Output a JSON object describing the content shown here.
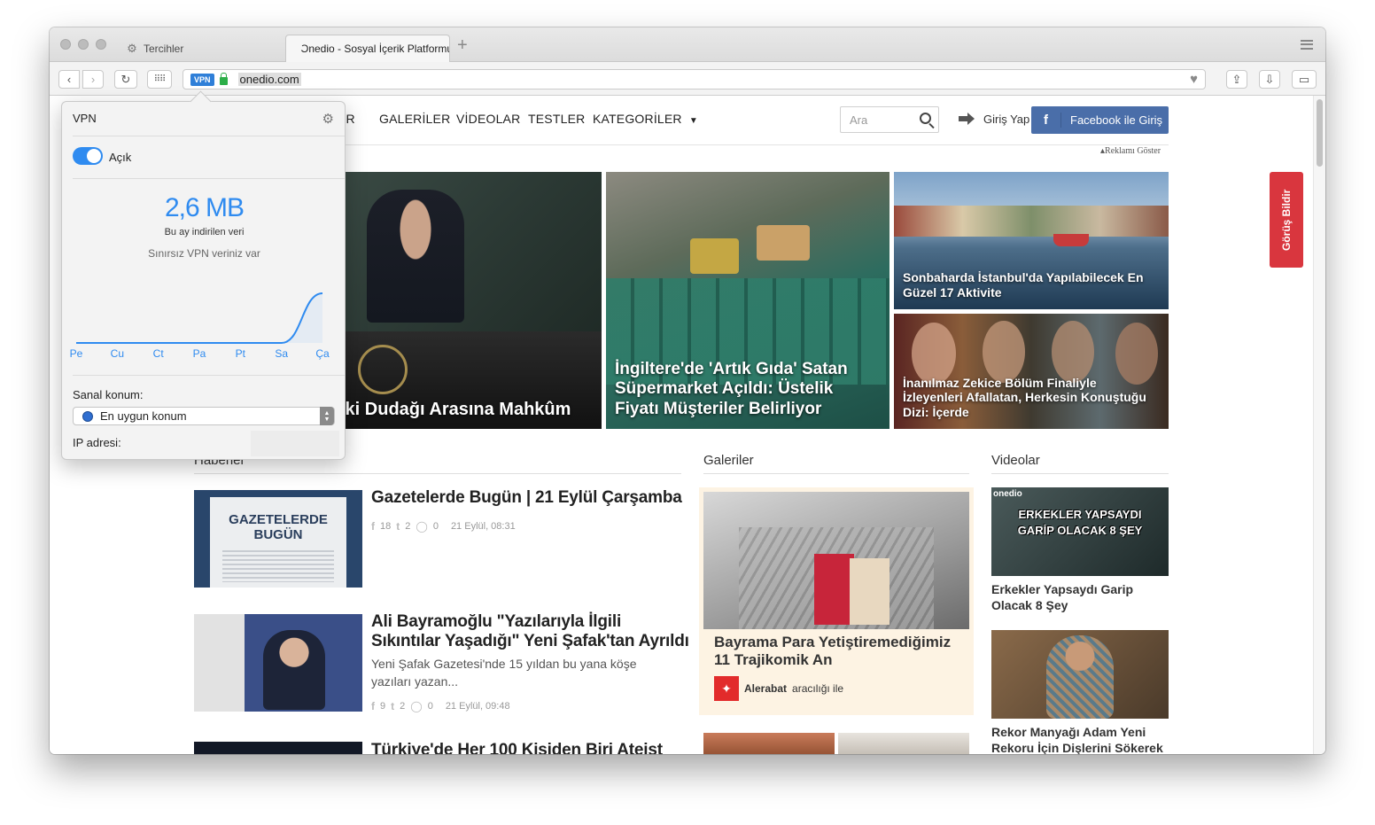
{
  "browser": {
    "tabs": [
      {
        "label": "Tercihler",
        "icon": "gear-icon",
        "active": false
      },
      {
        "label": "Onedio - Sosyal İçerik Platformu",
        "icon": "onedio-favicon",
        "active": true
      }
    ],
    "new_tab_label": "+",
    "url": "onedio.com",
    "vpn_badge": "VPN"
  },
  "site": {
    "nav": [
      "LER",
      "GALERİLER",
      "VİDEOLAR",
      "TESTLER",
      "KATEGORİLER"
    ],
    "search_placeholder": "Ara",
    "login_label": "Giriş Yap",
    "facebook_icon": "f",
    "facebook_label": "Facebook ile Giriş",
    "ad_note": "▴Reklamı Göster",
    "feedback_label": "Görüş Bildir",
    "hero": [
      {
        "caption": "İki Dudağı Arasına Mahkûm"
      },
      {
        "caption": "İngiltere'de 'Artık Gıda' Satan Süpermarket Açıldı: Üstelik Fiyatı Müşteriler Belirliyor"
      },
      {
        "caption": "Sonbaharda İstanbul'da Yapılabilecek En Güzel 17 Aktivite"
      },
      {
        "caption": "İnanılmaz Zekice Bölüm Finaliyle İzleyenleri Afallatan, Herkesin Konuştuğu Dizi: İçerde"
      }
    ],
    "sections": {
      "news": "Haberler",
      "galleries": "Galeriler",
      "videos": "Videolar"
    },
    "news": [
      {
        "title": "Gazetelerde Bugün | 21 Eylül Çarşamba",
        "desc": "",
        "fb": "18",
        "tw": "2",
        "wa": "0",
        "time": "21 Eylül, 08:31",
        "thumb_text_1": "GAZETELERDE",
        "thumb_text_2": "BUGÜN"
      },
      {
        "title": "Ali Bayramoğlu \"Yazılarıyla İlgili Sıkıntılar Yaşadığı\" Yeni Şafak'tan Ayrıldı",
        "desc": "Yeni Şafak Gazetesi'nde 15 yıldan bu yana köşe yazıları yazan...",
        "fb": "9",
        "tw": "2",
        "wa": "0",
        "time": "21 Eylül, 09:48"
      },
      {
        "title": "Türkiye'de Her 100 Kişiden Biri Ateist"
      }
    ],
    "meta_icons": {
      "fb": "f",
      "tw": "t",
      "wa": "◯"
    },
    "gallery": {
      "title": "Bayrama Para Yetiştiremediğimiz 11 Trajikomik An",
      "sponsor": "Alerabat",
      "sponsor_suffix": "aracılığı ile"
    },
    "videos": [
      {
        "title": "Erkekler Yapsaydı Garip Olacak 8 Şey",
        "thumb_text": "ERKEKLER YAPSAYDI GARİP OLACAK 8 ŞEY",
        "brand": "onedio"
      },
      {
        "title": "Rekor Manyağı Adam Yeni Rekoru İçin Dişlerini Sökerek"
      }
    ]
  },
  "vpn": {
    "title": "VPN",
    "toggle_label": "Açık",
    "amount": "2,6 MB",
    "amount_caption": "Bu ay indirilen veri",
    "unlimited": "Sınırsız VPN veriniz var",
    "days": [
      "Pe",
      "Cu",
      "Ct",
      "Pa",
      "Pt",
      "Sa",
      "Ça"
    ],
    "location_label": "Sanal konum:",
    "location_value": "En uygun konum",
    "ip_label": "IP adresi:"
  },
  "chart_data": {
    "type": "area",
    "categories": [
      "Pe",
      "Cu",
      "Ct",
      "Pa",
      "Pt",
      "Sa",
      "Ça"
    ],
    "values": [
      0,
      0,
      0,
      0,
      0,
      0,
      2.6
    ],
    "title": "",
    "xlabel": "",
    "ylabel": ""
  }
}
